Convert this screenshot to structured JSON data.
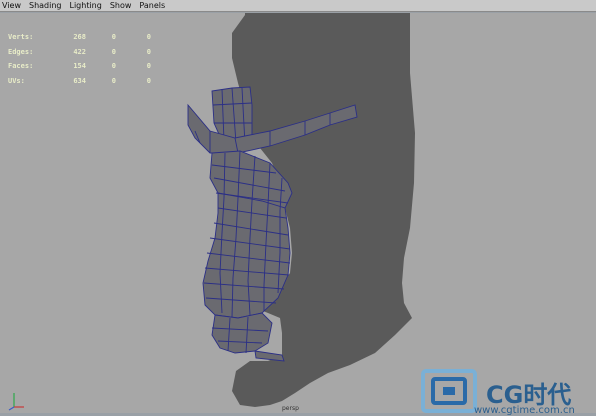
{
  "menu": {
    "items": [
      "View",
      "Shading",
      "Lighting",
      "Show",
      "Panels"
    ]
  },
  "hud": {
    "rows": [
      {
        "label": "Verts:",
        "v1": "268",
        "v2": "0",
        "v3": "0"
      },
      {
        "label": "Edges:",
        "v1": "422",
        "v2": "0",
        "v3": "0"
      },
      {
        "label": "Faces:",
        "v1": "154",
        "v2": "0",
        "v3": "0"
      },
      {
        "label": "UVs:",
        "v1": "634",
        "v2": "0",
        "v3": "0"
      }
    ]
  },
  "camera_label": "persp",
  "watermark": {
    "brand": "CG时代",
    "url": "www.cgtime.com.cn"
  },
  "colors": {
    "viewport_bg": "#a7a7a7",
    "silhouette": "#5a5a5a",
    "mesh_face": "#6a6a70",
    "wire": "#2b2f86"
  }
}
